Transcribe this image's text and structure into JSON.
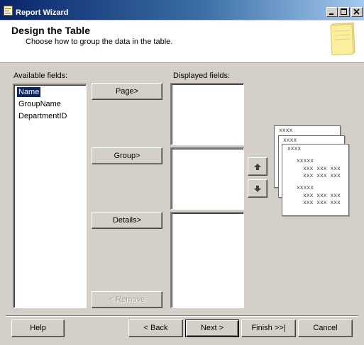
{
  "window": {
    "title": "Report Wizard"
  },
  "header": {
    "title": "Design the Table",
    "subtitle": "Choose how to group the data in the table."
  },
  "available": {
    "label": "Available fields:",
    "items": [
      "Name",
      "GroupName",
      "DepartmentID"
    ],
    "selected": "Name"
  },
  "displayed": {
    "label": "Displayed fields:"
  },
  "buttons": {
    "page": "Page>",
    "group": "Group>",
    "details": "Details>",
    "remove": "< Remove",
    "help": "Help",
    "back": "< Back",
    "next": "Next >",
    "finish": "Finish >>|",
    "cancel": "Cancel"
  },
  "preview": {
    "header1": "xxxx",
    "header2": "xxxx",
    "header3": "xxxx",
    "group1": "xxxxx",
    "row1": "xxx xxx xxx",
    "row2": "xxx xxx xxx",
    "group2": "xxxxx",
    "row3": "xxx xxx xxx",
    "row4": "xxx xxx xxx"
  },
  "colors": {
    "title_bar": "#0a246a",
    "selection": "#0a246a",
    "face": "#d4d0c8"
  }
}
